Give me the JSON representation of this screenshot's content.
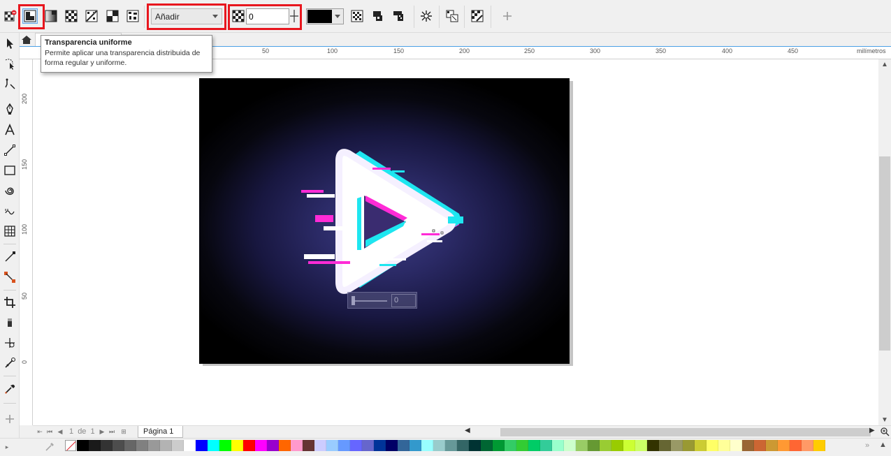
{
  "property_bar": {
    "merge_mode": "Añadir",
    "transparency_value": "0"
  },
  "tooltip": {
    "title": "Transparencia uniforme",
    "description": "Permite aplicar una transparencia distribuida de forma regular y uniforme."
  },
  "document": {
    "tab_title": ""
  },
  "ruler": {
    "unit": "milímetros",
    "top_labels": [
      "50",
      "100",
      "150",
      "200",
      "250",
      "300",
      "350",
      "400",
      "450"
    ],
    "left_labels": [
      "200",
      "150",
      "100",
      "50",
      "0"
    ]
  },
  "artwork": {
    "mini_slider_value": "0"
  },
  "page_nav": {
    "current": "1",
    "of_label": "de",
    "total": "1",
    "page_tab": "Página 1"
  },
  "palette": {
    "colors": [
      "#000000",
      "#1a1a1a",
      "#333333",
      "#4d4d4d",
      "#666666",
      "#808080",
      "#999999",
      "#b3b3b3",
      "#cccccc",
      "#ffffff",
      "#0000ff",
      "#00ffff",
      "#00ff00",
      "#ffff00",
      "#ff0000",
      "#ff00ff",
      "#9900cc",
      "#ff6600",
      "#ff99cc",
      "#663333",
      "#ccccff",
      "#99ccff",
      "#6699ff",
      "#6666ff",
      "#6666cc",
      "#003399",
      "#000066",
      "#336699",
      "#3399cc",
      "#99ffff",
      "#99cccc",
      "#669999",
      "#336666",
      "#003333",
      "#006633",
      "#009933",
      "#33cc66",
      "#33cc33",
      "#00cc66",
      "#33cc99",
      "#99ffcc",
      "#ccffcc",
      "#99cc66",
      "#669933",
      "#99cc33",
      "#99cc00",
      "#ccff33",
      "#ccff66",
      "#333300",
      "#666633",
      "#999966",
      "#999933",
      "#cccc33",
      "#ffff66",
      "#ffff99",
      "#ffffcc",
      "#996633",
      "#cc6633",
      "#cc9933",
      "#ff9933",
      "#ff6633",
      "#ff9966",
      "#ffcc00"
    ]
  },
  "colors": {
    "accent_blue": "#4aa0e6",
    "highlight_red": "#e8161e",
    "glitch_magenta": "#ff2bd6",
    "glitch_cyan": "#1ee6f0"
  }
}
